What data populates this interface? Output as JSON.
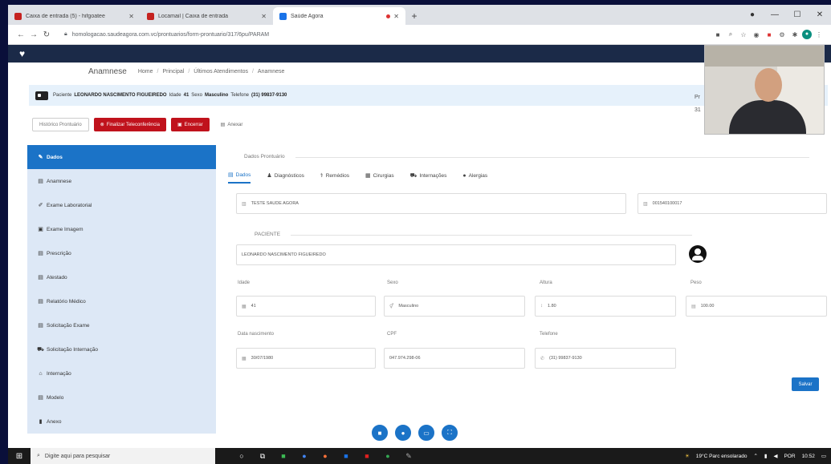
{
  "browser": {
    "tabs": [
      {
        "label": "Caixa de entrada (5) - hifgoatee",
        "color": "#c5221f"
      },
      {
        "label": "Locamail | Caixa de entrada",
        "color": "#c5221f"
      },
      {
        "label": "Saúde Agora",
        "color": "#1a73e8",
        "active": true
      }
    ],
    "url": "homologacao.saudeagora.com.vc/prontuarios/form-prontuario/317/6pu/PARAM",
    "window_controls": [
      "—",
      "☐",
      "✕"
    ]
  },
  "breadcrumb": {
    "title": "Anamnese",
    "items": [
      "Home",
      "Principal",
      "Últimos Atendimentos",
      "Anamnese"
    ]
  },
  "patient": {
    "label_paciente": "Paciente",
    "name": "LEONARDO NASCIMENTO FIGUEIREDO",
    "label_idade": "Idade",
    "idade": "41",
    "label_sexo": "Sexo",
    "sexo": "Masculino",
    "label_telefone": "Telefone",
    "telefone": "(31) 99837-9130"
  },
  "actions": {
    "historico": "Histórico Prontuário",
    "finalizar": "Finalizar Teleconferência",
    "encerrar": "Encerrar",
    "anexar": "Anexar"
  },
  "sidebar": {
    "items": [
      {
        "label": "Dados",
        "icon": "tag-icon",
        "glyph": "✎",
        "active": true
      },
      {
        "label": "Anamnese",
        "icon": "doc-icon",
        "glyph": "▤"
      },
      {
        "label": "Exame Laboratorial",
        "icon": "pen-icon",
        "glyph": "✐"
      },
      {
        "label": "Exame Imagem",
        "icon": "image-icon",
        "glyph": "▣"
      },
      {
        "label": "Prescrição",
        "icon": "doc-icon",
        "glyph": "▤"
      },
      {
        "label": "Atestado",
        "icon": "doc-icon",
        "glyph": "▤"
      },
      {
        "label": "Relatório Médico",
        "icon": "doc-icon",
        "glyph": "▤"
      },
      {
        "label": "Solicitação Exame",
        "icon": "doc-icon",
        "glyph": "▤"
      },
      {
        "label": "Solicitação Internação",
        "icon": "ambulance-icon",
        "glyph": "⛟"
      },
      {
        "label": "Internação",
        "icon": "hospital-icon",
        "glyph": "⌂"
      },
      {
        "label": "Modelo",
        "icon": "doc-icon",
        "glyph": "▤"
      },
      {
        "label": "Anexo",
        "icon": "file-icon",
        "glyph": "▮"
      }
    ]
  },
  "form": {
    "legend": "Dados Prontuário",
    "tabs": [
      {
        "label": "Dados",
        "glyph": "▤",
        "active": true
      },
      {
        "label": "Diagnósticos",
        "glyph": "♟"
      },
      {
        "label": "Remédios",
        "glyph": "⚕"
      },
      {
        "label": "Cirurgias",
        "glyph": "▦"
      },
      {
        "label": "Internações",
        "glyph": "⛟"
      },
      {
        "label": "Alergias",
        "glyph": "●"
      }
    ],
    "empresa": "TESTE SAUDE AGORA",
    "codigo": "001540100017",
    "paciente_legend": "PACIENTE",
    "paciente_nome": "LEONARDO NASCIMENTO FIGUEIREDO",
    "labels": {
      "idade": "Idade",
      "sexo": "Sexo",
      "altura": "Altura",
      "peso": "Peso",
      "nascimento": "Data nascimento",
      "cpf": "CPF",
      "telefone": "Telefone"
    },
    "values": {
      "idade": "41",
      "sexo": "Masculino",
      "altura": "1.80",
      "peso": "100.00",
      "nascimento": "30/07/1980",
      "cpf": "047.974.298-06",
      "telefone": "(31) 99837-9130"
    },
    "save": "Salvar"
  },
  "side_truncated": [
    "Pr",
    "31"
  ],
  "taskbar": {
    "search_placeholder": "Digite aqui para pesquisar",
    "weather": "19°C Parc ensolarado",
    "lang": "POR",
    "time": "10:52"
  },
  "colors": {
    "primary": "#1b73c7",
    "danger": "#c0121c",
    "navbar": "#1b2a48",
    "banner": "#e6f1fb",
    "sidebar": "#dde8f6"
  }
}
